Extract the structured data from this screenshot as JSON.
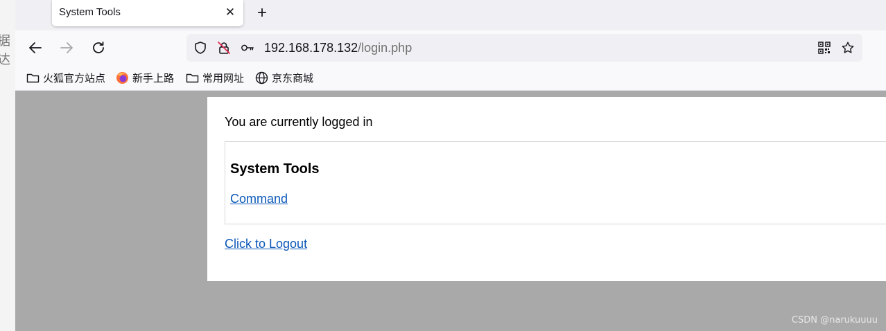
{
  "left_peek_text": "据达",
  "tab": {
    "title": "System Tools",
    "close_glyph": "✕",
    "new_tab_glyph": "+"
  },
  "nav": {
    "url_host": "192.168.178.132",
    "url_path": "/login.php"
  },
  "bookmarks": [
    {
      "label": "火狐官方站点",
      "icon": "folder-icon"
    },
    {
      "label": "新手上路",
      "icon": "firefox-icon"
    },
    {
      "label": "常用网址",
      "icon": "folder-icon"
    },
    {
      "label": "京东商城",
      "icon": "globe-icon"
    }
  ],
  "page": {
    "status_text": "You are currently logged in",
    "tools_heading": "System Tools",
    "command_link": "Command",
    "logout_link": "Click to Logout"
  },
  "watermark": "CSDN @narukuuuu",
  "colors": {
    "link": "#0b57b8",
    "viewport_bg": "#a9a9a9"
  }
}
